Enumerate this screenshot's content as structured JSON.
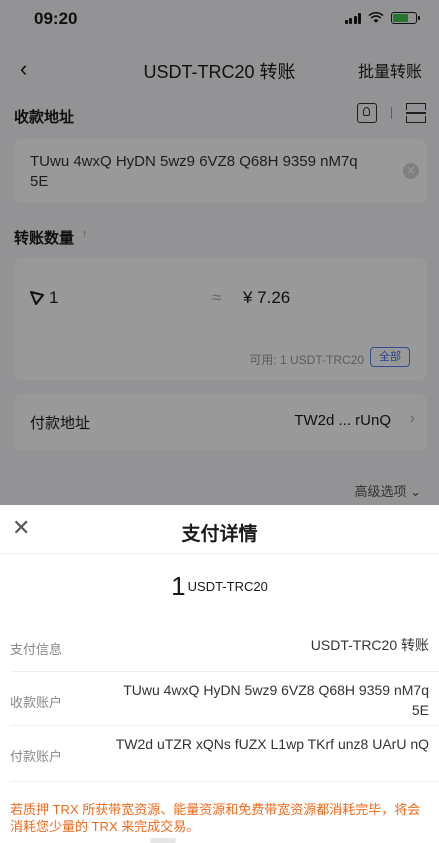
{
  "status": {
    "time": "09:20"
  },
  "nav": {
    "title": "USDT-TRC20 转账",
    "right": "批量转账"
  },
  "recipient": {
    "label": "收款地址",
    "address": "TUwu 4wxQ HyDN 5wz9 6VZ8 Q68H 9359 nM7q 5E"
  },
  "amount": {
    "label": "转账数量",
    "sublabel": "↑",
    "value": "1",
    "approx": "≈",
    "cny": "¥ 7.26",
    "available": "可用: 1 USDT-TRC20",
    "all_button": "全部"
  },
  "payer": {
    "label": "付款地址",
    "value": "TW2d ... rUnQ"
  },
  "advanced": "高级选项",
  "sheet": {
    "title": "支付详情",
    "amount": "1",
    "unit": "USDT-TRC20",
    "rows": [
      {
        "label": "支付信息",
        "value": "USDT-TRC20 转账"
      },
      {
        "label": "收款账户",
        "value": "TUwu 4wxQ HyDN 5wz9 6VZ8 Q68H 9359 nM7q 5E"
      },
      {
        "label": "付款账户",
        "value": "TW2d uTZR xQNs fUZX L1wp TKrf unz8 UArU nQ"
      }
    ],
    "warning": "若质押 TRX 所获带宽资源、能量资源和免费带宽资源都消耗完毕，将会消耗您少量的 TRX 来完成交易。"
  },
  "colors": {
    "accent": "#4a6fe8",
    "warning": "#ee6a1c",
    "battery": "#43c251"
  }
}
